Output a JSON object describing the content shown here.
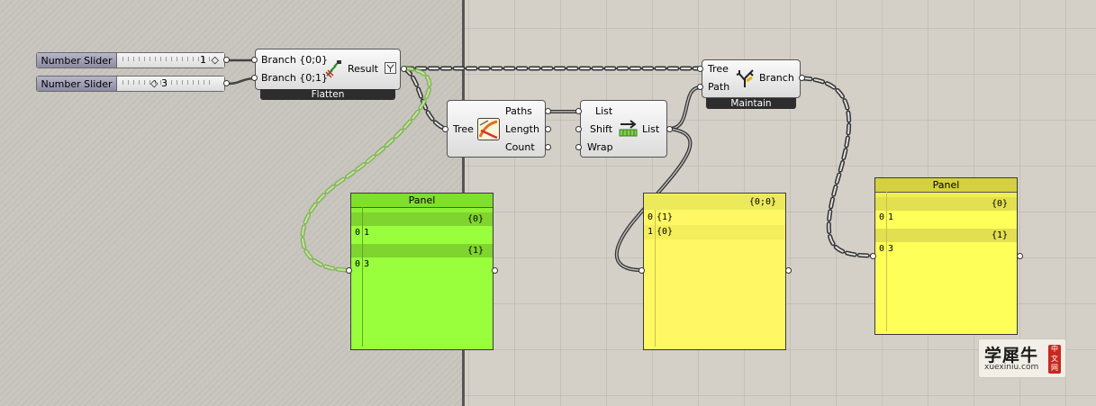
{
  "colors": {
    "canvas": "#d4d0c8",
    "wire": "#555555",
    "wire_selected": "#7fc547",
    "panel_green": "#99ff3c",
    "panel_yellow": "#fff764",
    "slider_label_bg": "#9c9ab2"
  },
  "sliders": [
    {
      "label": "Number Slider",
      "value": "1",
      "marker": "◇"
    },
    {
      "label": "Number Slider",
      "value": "3",
      "marker": "◇"
    }
  ],
  "flatten": {
    "name": "Flatten",
    "inputs": [
      "Branch {0;0}",
      "Branch {0;1}"
    ],
    "output": "Result",
    "icon": "flatten-icon",
    "graft_badge": "graft-icon"
  },
  "param_viewer": {
    "input": "Tree",
    "outputs": [
      "Paths",
      "Length",
      "Count"
    ],
    "icon": "param-viewer-icon"
  },
  "shift_list": {
    "inputs": [
      "List",
      "Shift",
      "Wrap"
    ],
    "output": "List",
    "icon": "shift-list-icon"
  },
  "tree_branch": {
    "name": "Maintain",
    "inputs": [
      "Tree",
      "Path"
    ],
    "output": "Branch",
    "icon": "tree-branch-icon"
  },
  "panels": [
    {
      "title": "Panel",
      "color": "#99ff3c",
      "rows": [
        {
          "type": "band",
          "text": "{0}"
        },
        {
          "type": "item",
          "index": "0",
          "value": "1"
        },
        {
          "type": "band",
          "text": "{1}"
        },
        {
          "type": "item",
          "index": "0",
          "value": "3"
        }
      ]
    },
    {
      "title": "",
      "color": "#fff764",
      "rows": [
        {
          "type": "band",
          "text": "{0;0}"
        },
        {
          "type": "item",
          "index": "0",
          "value": "{1}"
        },
        {
          "type": "item",
          "index": "1",
          "value": "{0}"
        }
      ]
    },
    {
      "title": "Panel",
      "color": "#ffff5a",
      "rows": [
        {
          "type": "band",
          "text": "{0}"
        },
        {
          "type": "item",
          "index": "0",
          "value": "1"
        },
        {
          "type": "band",
          "text": "{1}"
        },
        {
          "type": "item",
          "index": "0",
          "value": "3"
        }
      ]
    }
  ],
  "watermark": {
    "main": "学犀牛",
    "sub": "xuexiniu.com",
    "seal": "中文网"
  }
}
